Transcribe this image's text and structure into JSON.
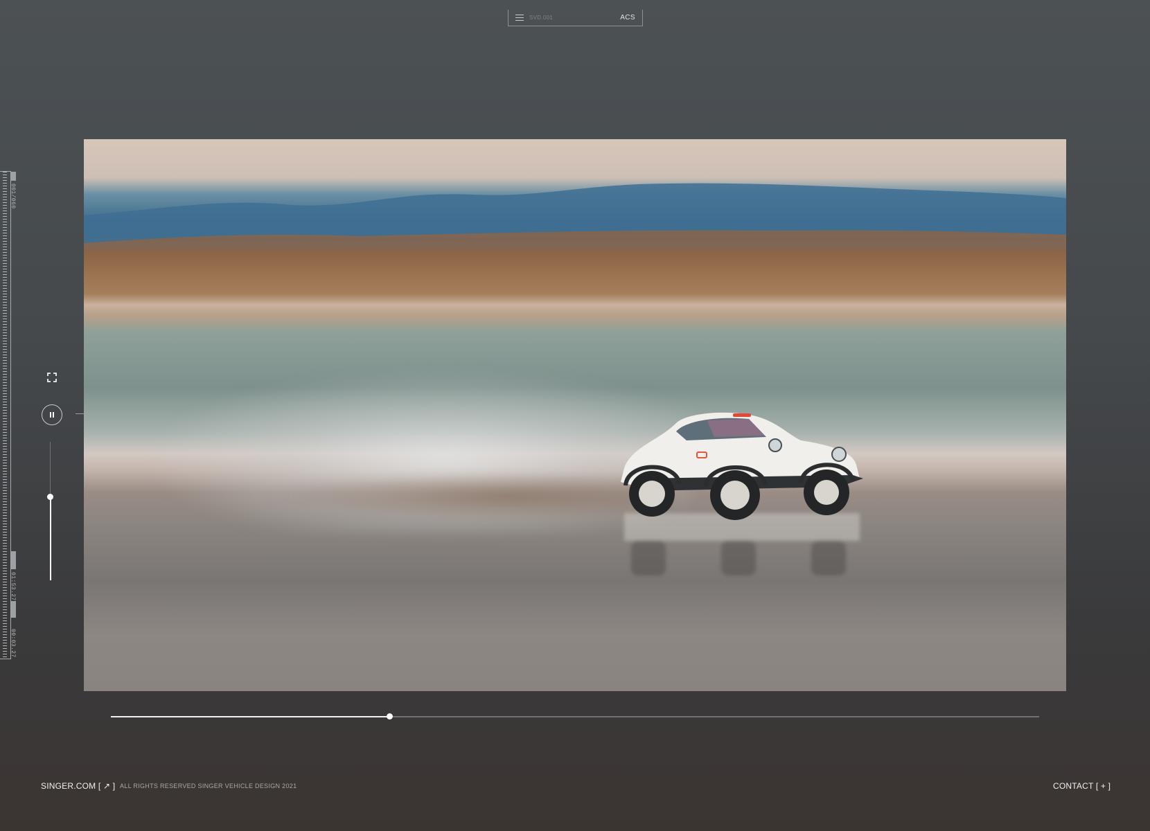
{
  "topnav": {
    "menu_icon": "menu-icon",
    "code": "SVD.001",
    "right_label": "ACS"
  },
  "ruler": {
    "top_label": "001/060",
    "mid_label": "01:53.27",
    "bottom_label": "00:03.27"
  },
  "video": {
    "description_icon": "video-frame",
    "playback_state": "playing",
    "progress_fraction": 0.3,
    "volume_fraction": 0.6
  },
  "controls": {
    "fullscreen_icon": "fullscreen-icon",
    "pause_icon": "pause-icon"
  },
  "footer": {
    "site_link": "SINGER.COM [ ↗ ]",
    "rights": "ALL RIGHTS RESERVED SINGER VEHICLE DESIGN 2021",
    "contact": "CONTACT [ + ]"
  }
}
